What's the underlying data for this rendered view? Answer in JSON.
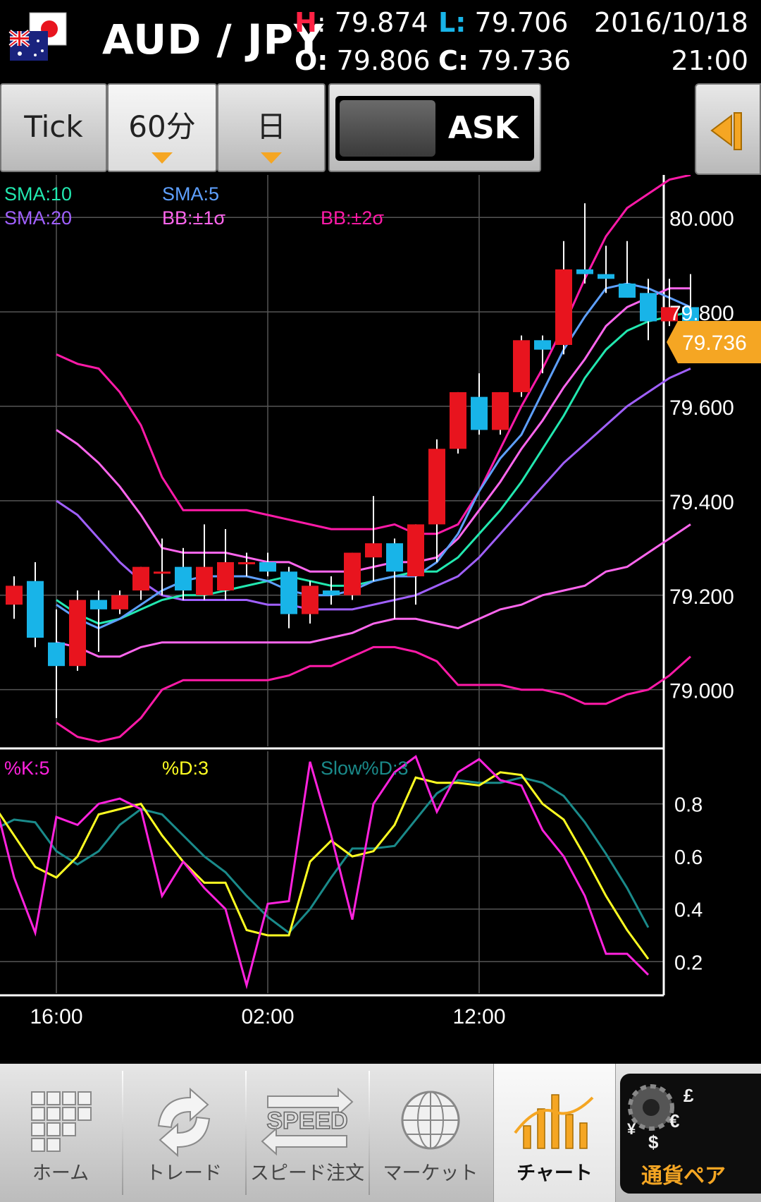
{
  "header": {
    "pair": "AUD / JPY",
    "high_label": "H",
    "high": "79.874",
    "low_label": "L:",
    "low": "79.706",
    "open_label": "O:",
    "open": "79.806",
    "close_label": "C:",
    "close": "79.736",
    "date": "2016/10/18",
    "time": "21:00"
  },
  "toolbar": {
    "tabs": [
      {
        "label": "Tick",
        "active": false,
        "has_dropdown": false
      },
      {
        "label": "60分",
        "active": true,
        "has_dropdown": true
      },
      {
        "label": "日",
        "active": false,
        "has_dropdown": true
      }
    ],
    "ask_label": "ASK",
    "side_icon": "collapse-left-icon"
  },
  "colors": {
    "sma5": "#5ea0ff",
    "sma10": "#22e8b0",
    "sma20": "#a060ff",
    "bb1": "#ff66ee",
    "bb2": "#ff1aa8",
    "up": "#e8141e",
    "down": "#18b4e8",
    "k": "#ff22dd",
    "d": "#ffff22",
    "slow_d": "#1a8a8a",
    "price_tag": "#f5a623",
    "high_label": "#ff2244",
    "low_label": "#18b4e8"
  },
  "legend": {
    "sma10": "SMA:10",
    "sma5": "SMA:5",
    "sma20": "SMA:20",
    "bb1": "BB:±1σ",
    "bb2": "BB:±2σ",
    "k": "%K:5",
    "d": "%D:3",
    "slow_d": "Slow%D:3"
  },
  "price_tag": "79.736",
  "chart_data": [
    {
      "type": "candlestick",
      "y_ticks": [
        "80.000",
        "79.800",
        "79.600",
        "79.400",
        "79.200",
        "79.000"
      ],
      "y_tick_values": [
        80.0,
        79.8,
        79.6,
        79.4,
        79.2,
        79.0
      ],
      "ylim": [
        78.88,
        80.09
      ],
      "x_ticks": [
        "16:00",
        "02:00",
        "12:00"
      ],
      "x_tick_index": [
        2,
        12,
        22
      ],
      "candles": [
        {
          "o": 79.18,
          "h": 79.24,
          "l": 79.15,
          "c": 79.22
        },
        {
          "o": 79.23,
          "h": 79.27,
          "l": 79.09,
          "c": 79.11
        },
        {
          "o": 79.1,
          "h": 79.17,
          "l": 78.94,
          "c": 79.05
        },
        {
          "o": 79.05,
          "h": 79.21,
          "l": 79.04,
          "c": 79.19
        },
        {
          "o": 79.19,
          "h": 79.21,
          "l": 79.08,
          "c": 79.17
        },
        {
          "o": 79.17,
          "h": 79.21,
          "l": 79.16,
          "c": 79.2
        },
        {
          "o": 79.21,
          "h": 79.26,
          "l": 79.19,
          "c": 79.26
        },
        {
          "o": 79.25,
          "h": 79.32,
          "l": 79.2,
          "c": 79.25
        },
        {
          "o": 79.26,
          "h": 79.3,
          "l": 79.19,
          "c": 79.21
        },
        {
          "o": 79.2,
          "h": 79.35,
          "l": 79.19,
          "c": 79.26
        },
        {
          "o": 79.21,
          "h": 79.34,
          "l": 79.19,
          "c": 79.27
        },
        {
          "o": 79.27,
          "h": 79.29,
          "l": 79.24,
          "c": 79.27
        },
        {
          "o": 79.27,
          "h": 79.29,
          "l": 79.24,
          "c": 79.25
        },
        {
          "o": 79.25,
          "h": 79.26,
          "l": 79.13,
          "c": 79.16
        },
        {
          "o": 79.16,
          "h": 79.23,
          "l": 79.14,
          "c": 79.22
        },
        {
          "o": 79.21,
          "h": 79.24,
          "l": 79.18,
          "c": 79.2
        },
        {
          "o": 79.2,
          "h": 79.29,
          "l": 79.19,
          "c": 79.29
        },
        {
          "o": 79.28,
          "h": 79.41,
          "l": 79.23,
          "c": 79.31
        },
        {
          "o": 79.31,
          "h": 79.32,
          "l": 79.15,
          "c": 79.25
        },
        {
          "o": 79.24,
          "h": 79.35,
          "l": 79.18,
          "c": 79.35
        },
        {
          "o": 79.35,
          "h": 79.53,
          "l": 79.27,
          "c": 79.51
        },
        {
          "o": 79.51,
          "h": 79.63,
          "l": 79.5,
          "c": 79.63
        },
        {
          "o": 79.62,
          "h": 79.67,
          "l": 79.54,
          "c": 79.55
        },
        {
          "o": 79.55,
          "h": 79.63,
          "l": 79.54,
          "c": 79.63
        },
        {
          "o": 79.63,
          "h": 79.75,
          "l": 79.62,
          "c": 79.74
        },
        {
          "o": 79.74,
          "h": 79.75,
          "l": 79.67,
          "c": 79.72
        },
        {
          "o": 79.73,
          "h": 79.95,
          "l": 79.71,
          "c": 79.89
        },
        {
          "o": 79.89,
          "h": 80.03,
          "l": 79.86,
          "c": 79.88
        },
        {
          "o": 79.88,
          "h": 79.94,
          "l": 79.84,
          "c": 79.87
        },
        {
          "o": 79.86,
          "h": 79.95,
          "l": 79.83,
          "c": 79.83
        },
        {
          "o": 79.84,
          "h": 79.87,
          "l": 79.74,
          "c": 79.78
        },
        {
          "o": 79.78,
          "h": 79.87,
          "l": 79.77,
          "c": 79.81
        },
        {
          "o": 79.81,
          "h": 79.88,
          "l": 79.71,
          "c": 79.736
        }
      ],
      "series": [
        {
          "key": "bb2_upper",
          "values": [
            79.71,
            79.69,
            79.68,
            79.63,
            79.56,
            79.45,
            79.38,
            79.38,
            79.38,
            79.38,
            79.37,
            79.36,
            79.35,
            79.34,
            79.34,
            79.34,
            79.35,
            79.33,
            79.33,
            79.35,
            79.42,
            79.51,
            79.6,
            79.68,
            79.77,
            79.87,
            79.96,
            80.02,
            80.05,
            80.08,
            80.09
          ]
        },
        {
          "key": "bb1_upper",
          "values": [
            79.55,
            79.52,
            79.48,
            79.43,
            79.37,
            79.3,
            79.29,
            79.29,
            79.29,
            79.28,
            79.27,
            79.27,
            79.25,
            79.25,
            79.25,
            79.26,
            79.27,
            79.27,
            79.28,
            79.32,
            79.38,
            79.44,
            79.51,
            79.57,
            79.64,
            79.7,
            79.77,
            79.81,
            79.83,
            79.85,
            79.85
          ]
        },
        {
          "key": "sma20",
          "values": [
            79.4,
            79.37,
            79.32,
            79.27,
            79.23,
            79.2,
            79.19,
            79.19,
            79.19,
            79.19,
            79.18,
            79.18,
            79.17,
            79.17,
            79.17,
            79.18,
            79.19,
            79.2,
            79.22,
            79.24,
            79.28,
            79.33,
            79.38,
            79.43,
            79.48,
            79.52,
            79.56,
            79.6,
            79.63,
            79.66,
            79.68
          ]
        },
        {
          "key": "sma10",
          "values": [
            79.19,
            79.16,
            79.14,
            79.15,
            79.17,
            79.19,
            79.2,
            79.2,
            79.21,
            79.22,
            79.23,
            79.24,
            79.23,
            79.22,
            79.22,
            79.23,
            79.24,
            79.25,
            79.25,
            79.28,
            79.33,
            79.38,
            79.44,
            79.51,
            79.58,
            79.66,
            79.72,
            79.76,
            79.78,
            79.79,
            79.8
          ]
        },
        {
          "key": "sma5",
          "values": [
            79.18,
            79.15,
            79.13,
            79.15,
            79.18,
            79.21,
            79.23,
            79.24,
            79.24,
            79.24,
            79.23,
            79.21,
            79.2,
            79.2,
            79.21,
            79.23,
            79.24,
            79.24,
            79.27,
            79.33,
            79.42,
            79.49,
            79.54,
            79.63,
            79.72,
            79.79,
            79.85,
            79.86,
            79.85,
            79.83,
            79.81
          ]
        },
        {
          "key": "bb1_lower",
          "values": [
            79.1,
            79.09,
            79.07,
            79.07,
            79.09,
            79.1,
            79.1,
            79.1,
            79.1,
            79.1,
            79.1,
            79.1,
            79.1,
            79.11,
            79.12,
            79.14,
            79.15,
            79.15,
            79.14,
            79.13,
            79.15,
            79.17,
            79.18,
            79.2,
            79.21,
            79.22,
            79.25,
            79.26,
            79.29,
            79.32,
            79.35
          ]
        },
        {
          "key": "bb2_lower",
          "values": [
            78.93,
            78.9,
            78.89,
            78.9,
            78.94,
            79.0,
            79.02,
            79.02,
            79.02,
            79.02,
            79.02,
            79.03,
            79.05,
            79.05,
            79.07,
            79.09,
            79.09,
            79.08,
            79.06,
            79.01,
            79.01,
            79.01,
            79.0,
            79.0,
            78.99,
            78.97,
            78.97,
            78.99,
            79.0,
            79.03,
            79.07
          ]
        }
      ]
    },
    {
      "type": "line",
      "y_ticks": [
        "0.8",
        "0.6",
        "0.4",
        "0.2"
      ],
      "y_tick_values": [
        0.8,
        0.6,
        0.4,
        0.2
      ],
      "ylim": [
        0.08,
        1.0
      ],
      "series": [
        {
          "key": "k",
          "name": "%K:5",
          "values": [
            0.84,
            0.52,
            0.31,
            0.75,
            0.72,
            0.8,
            0.82,
            0.78,
            0.45,
            0.58,
            0.48,
            0.4,
            0.11,
            0.42,
            0.43,
            0.96,
            0.68,
            0.36,
            0.8,
            0.92,
            0.98,
            0.77,
            0.92,
            0.97,
            0.89,
            0.87,
            0.7,
            0.6,
            0.45,
            0.23,
            0.23,
            0.15
          ]
        },
        {
          "key": "d",
          "name": "%D:3",
          "values": [
            0.8,
            0.68,
            0.56,
            0.52,
            0.6,
            0.76,
            0.78,
            0.8,
            0.68,
            0.58,
            0.5,
            0.5,
            0.32,
            0.3,
            0.3,
            0.58,
            0.66,
            0.6,
            0.62,
            0.72,
            0.9,
            0.88,
            0.88,
            0.87,
            0.92,
            0.91,
            0.8,
            0.74,
            0.6,
            0.45,
            0.32,
            0.21
          ]
        },
        {
          "key": "slow_d",
          "name": "Slow%D:3",
          "values": [
            0.7,
            0.74,
            0.73,
            0.62,
            0.57,
            0.62,
            0.72,
            0.78,
            0.76,
            0.68,
            0.6,
            0.54,
            0.45,
            0.37,
            0.31,
            0.4,
            0.52,
            0.63,
            0.63,
            0.64,
            0.74,
            0.84,
            0.89,
            0.88,
            0.88,
            0.9,
            0.88,
            0.83,
            0.73,
            0.61,
            0.48,
            0.33
          ]
        }
      ]
    }
  ],
  "bottom_nav": [
    {
      "label": "ホーム",
      "icon": "home-grid-icon",
      "active": false
    },
    {
      "label": "トレード",
      "icon": "trade-arrows-icon",
      "active": false
    },
    {
      "label": "スピード注文",
      "icon": "speed-order-icon",
      "active": false
    },
    {
      "label": "マーケット",
      "icon": "globe-icon",
      "active": false
    },
    {
      "label": "チャート",
      "icon": "chart-icon",
      "active": true
    },
    {
      "label": "通貨ペア",
      "icon": "currency-pair-icon",
      "active": false
    }
  ]
}
